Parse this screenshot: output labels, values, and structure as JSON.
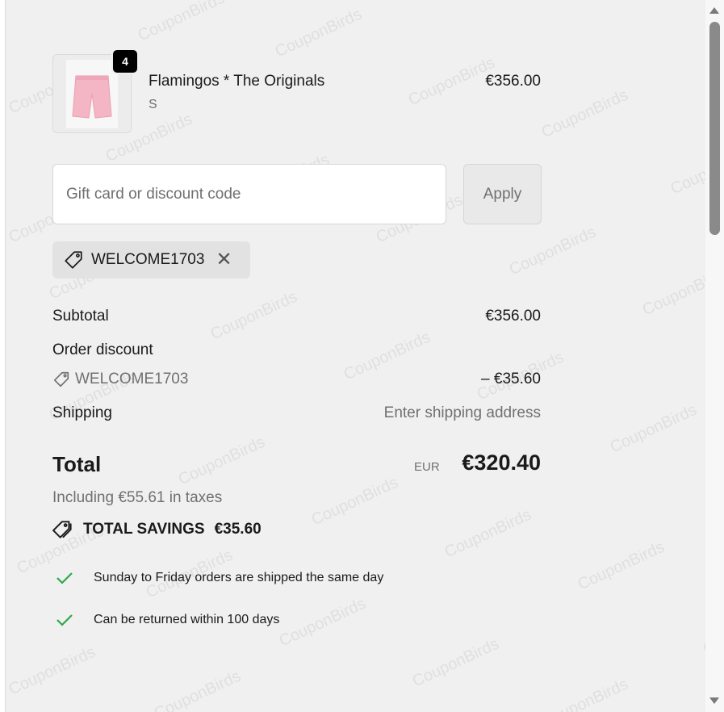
{
  "product": {
    "quantity_badge": "4",
    "name": "Flamingos * The Originals",
    "variant": "S",
    "price": "€356.00",
    "image_icon": "pink-shorts-image"
  },
  "discount": {
    "placeholder": "Gift card or discount code",
    "apply_label": "Apply",
    "applied_code": "WELCOME1703",
    "tag_icon": "tag-icon",
    "remove_icon": "close-icon"
  },
  "summary": {
    "subtotal_label": "Subtotal",
    "subtotal_value": "€356.00",
    "order_discount_label": "Order discount",
    "order_discount_code": "WELCOME1703",
    "order_discount_value": "– €35.60",
    "shipping_label": "Shipping",
    "shipping_value": "Enter shipping address",
    "total_label": "Total",
    "total_currency": "EUR",
    "total_value": "€320.40",
    "taxes_text": "Including €55.61 in taxes",
    "savings_label": "TOTAL SAVINGS",
    "savings_value": "€35.60"
  },
  "perks": [
    {
      "icon": "check-icon",
      "text": "Sunday to Friday orders are shipped the same day"
    },
    {
      "icon": "check-icon",
      "text": "Can be returned within 100 days"
    }
  ],
  "watermark_text": "CouponBirds",
  "colors": {
    "panel_bg": "#f0f0f0",
    "check_green": "#2ea84a",
    "badge_bg": "#000000"
  }
}
